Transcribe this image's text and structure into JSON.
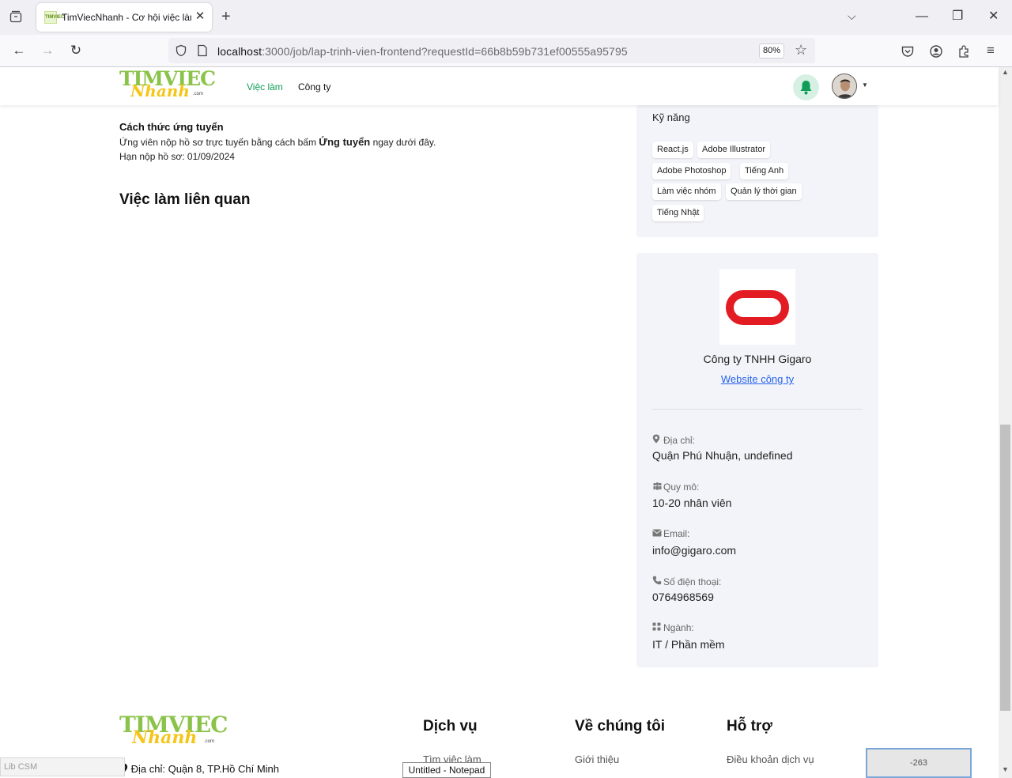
{
  "browser": {
    "tab_title": "TimViecNhanh - Cơ hội việc làm",
    "tab_favicon_text": "TIMVIEC",
    "url_host": "localhost",
    "url_rest": ":3000/job/lap-trinh-vien-frontend?requestId=66b8b59b731ef00555a95795",
    "zoom": "80%"
  },
  "site": {
    "logo_top": "TIMVIEC",
    "logo_bottom": "Nhanh",
    "logo_com": ".com",
    "nav": {
      "jobs": "Việc làm",
      "companies": "Công ty"
    },
    "accent_color": "#0f9d58"
  },
  "job": {
    "apply_heading": "Cách thức ứng tuyển",
    "apply_text_before": "Ứng viên nộp hồ sơ trực tuyến bằng cách bấm ",
    "apply_text_bold": "Ứng tuyển",
    "apply_text_after": " ngay dưới đây.",
    "deadline": "Hạn nộp hồ sơ: 01/09/2024",
    "related_heading": "Việc làm liên quan"
  },
  "skills": {
    "title": "Kỹ năng",
    "items": [
      "React.js",
      "Adobe Illustrator",
      "Adobe Photoshop",
      "Tiếng Anh",
      "Làm việc nhóm",
      "Quản lý thời gian",
      "Tiếng Nhật"
    ]
  },
  "company": {
    "name": "Công ty TNHH Gigaro",
    "website_label": "Website công ty",
    "logo_color": "#e31b23",
    "address_label": "Địa chỉ:",
    "address": "Quận Phú Nhuận, undefined",
    "size_label": "Quy mô:",
    "size": "10-20 nhân viên",
    "email_label": "Email:",
    "email": "info@gigaro.com",
    "phone_label": "Số điện thoại:",
    "phone": "0764968569",
    "industry_label": "Ngành:",
    "industry": "IT / Phần mềm"
  },
  "footer": {
    "address": "Địa chỉ: Quận 8, TP.Hồ Chí Minh",
    "col1_head": "Dịch vụ",
    "col1_link": "Tìm việc làm",
    "col2_head": "Về chúng tôi",
    "col2_link": "Giới thiệu",
    "col3_head": "Hỗ trợ",
    "col3_link": "Điều khoản dịch vụ"
  },
  "overlays": {
    "libcsm": "Lib CSM",
    "notepad": "Untitled - Notepad",
    "counter": "-263"
  }
}
